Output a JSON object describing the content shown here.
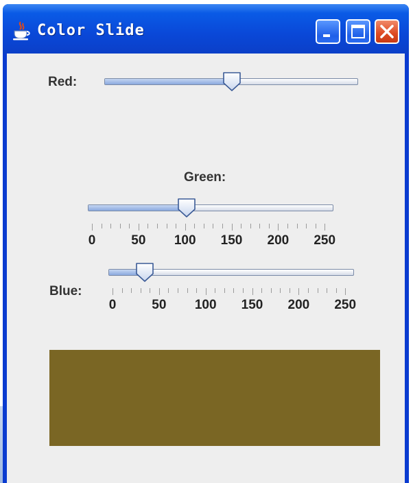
{
  "window": {
    "title": "Color Slide",
    "icon": "java-cup-icon",
    "controls": [
      "minimize-icon",
      "maximize-icon",
      "close-icon"
    ]
  },
  "sliders": {
    "red": {
      "label": "Red:",
      "min": 0,
      "max": 255,
      "value": 128,
      "show_ticks": false
    },
    "green": {
      "label": "Green:",
      "min": 0,
      "max": 255,
      "value": 102,
      "show_ticks": true,
      "tick_labels": [
        "0",
        "50",
        "100",
        "150",
        "200",
        "250"
      ]
    },
    "blue": {
      "label": "Blue:",
      "min": 0,
      "max": 255,
      "value": 35,
      "show_ticks": true,
      "tick_labels": [
        "0",
        "50",
        "100",
        "150",
        "200",
        "250"
      ]
    }
  },
  "color_preview": {
    "color": "#7a6624"
  }
}
